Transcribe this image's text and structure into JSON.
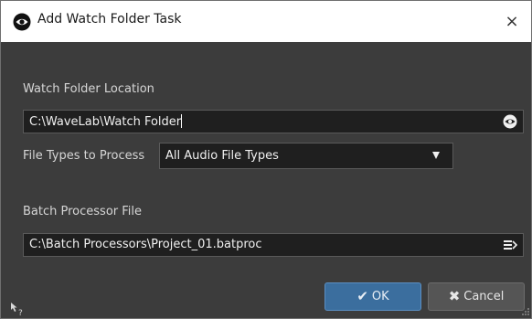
{
  "window": {
    "title": "Add Watch Folder Task",
    "title_icon": "eye-icon",
    "close_glyph": "×"
  },
  "watch_folder": {
    "label": "Watch Folder Location",
    "value": "C:\\WaveLab\\Watch Folder",
    "browse_icon": "eye-icon"
  },
  "file_types": {
    "label": "File Types to Process",
    "selected": "All Audio File Types",
    "dropdown_icon": "triangle-down-icon"
  },
  "batch_processor": {
    "label": "Batch Processor File",
    "value": "C:\\Batch Processors\\Project_01.batproc",
    "browse_icon": "list-open-icon"
  },
  "buttons": {
    "ok_label": "OK",
    "ok_icon": "checkmark-icon",
    "cancel_label": "Cancel",
    "cancel_icon": "x-icon"
  },
  "colors": {
    "ok_accent": "#3b6e9e",
    "dialog_bg": "#3c3c3c",
    "field_bg": "#1f1f1f"
  },
  "footer": {
    "help_icon": "whats-this-help-icon",
    "grip_icon": "resize-grip-icon"
  }
}
